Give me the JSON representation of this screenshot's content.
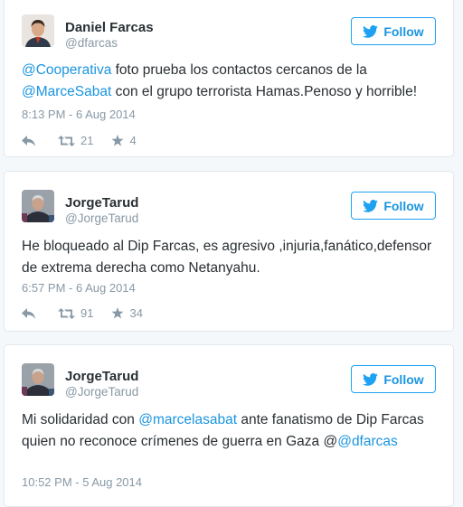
{
  "colors": {
    "accent": "#1b95e0",
    "muted": "#8899a6",
    "text": "#292f33",
    "border": "#e1e8ed"
  },
  "follow_label": "Follow",
  "tweets": [
    {
      "name": "Daniel Farcas",
      "handle": "@dfarcas",
      "text": {
        "m1": "@Cooperativa",
        "t1": " foto prueba los contactos cercanos de la ",
        "m2": "@MarceSabat",
        "t2": " con el grupo terrorista Hamas.Penoso y horrible!"
      },
      "timestamp": "8:13 PM - 6 Aug 2014",
      "retweets": "21",
      "favorites": "4"
    },
    {
      "name": "JorgeTarud",
      "handle": "@JorgeTarud",
      "text": {
        "t1": "He bloqueado al Dip Farcas, es agresivo ,injuria,fanático,defensor de extrema derecha como Netanyahu."
      },
      "timestamp": "6:57 PM - 6 Aug 2014",
      "retweets": "91",
      "favorites": "34"
    },
    {
      "name": "JorgeTarud",
      "handle": "@JorgeTarud",
      "text": {
        "t1": "Mi solidaridad con ",
        "m1": "@marcelasabat",
        "t2": " ante fanatismo de Dip Farcas quien no reconoce crímenes de guerra en Gaza @",
        "m2": "@dfarcas"
      },
      "timestamp": "10:52 PM - 5 Aug 2014"
    }
  ]
}
